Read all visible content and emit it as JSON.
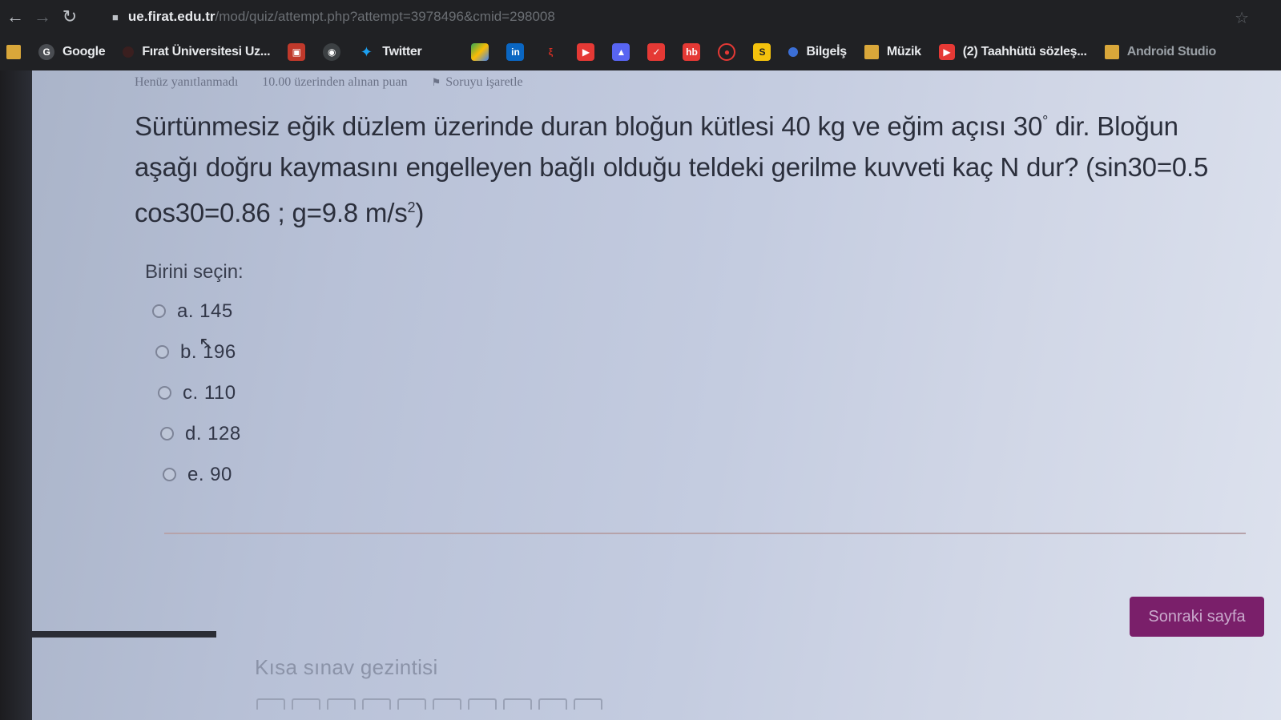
{
  "browser": {
    "url_host": "ue.firat.edu.tr",
    "url_path": "/mod/quiz/attempt.php?attempt=3978496&cmid=298008",
    "bookmarks": {
      "google": "Google",
      "firat": "Fırat Üniversitesi Uz...",
      "twitter": "Twitter",
      "bilgeis": "Bilgeİş",
      "muzik": "Müzik",
      "taahhut": "(2) Taahhütü sözleş...",
      "android": "Android Studio"
    }
  },
  "quiz": {
    "status": "Henüz yanıtlanmadı",
    "points": "10.00 üzerinden alınan puan",
    "flag_label": "Soruyu işaretle",
    "question_line1": "Sürtünmesiz eğik düzlem üzerinde duran bloğun kütlesi 40 kg ve eğim açısı 30",
    "question_degree": "°",
    "question_line1_end": " dir. Bloğun",
    "question_line2": "aşağı doğru kaymasını engelleyen bağlı olduğu teldeki gerilme kuvveti kaç N dur? (sin30=0.5",
    "question_line3": "cos30=0.86 ;  g=9.8 m/s",
    "question_exp": "2",
    "question_line3_end": ")",
    "prompt": "Birini seçin:",
    "options": [
      {
        "label": "a. 145"
      },
      {
        "label": "b. 196"
      },
      {
        "label": "c. 110"
      },
      {
        "label": "d. 128"
      },
      {
        "label": "e. 90"
      }
    ],
    "next_button": "Sonraki sayfa",
    "navigation_title": "Kısa sınav gezintisi"
  }
}
